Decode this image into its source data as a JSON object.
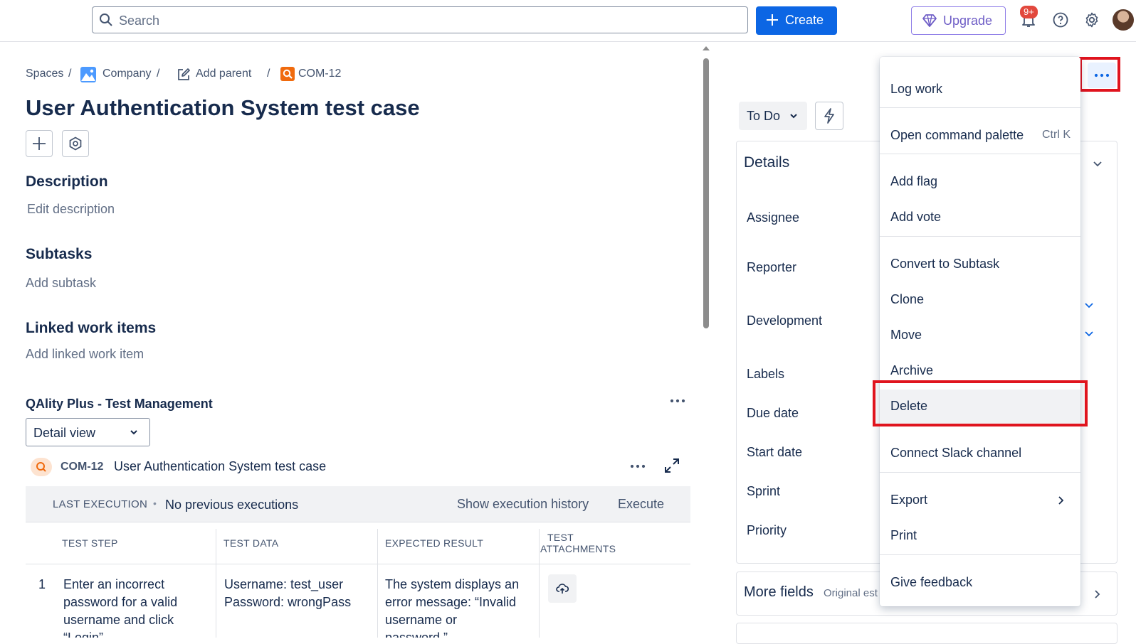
{
  "topbar": {
    "search_placeholder": "Search",
    "create_label": "Create",
    "upgrade_label": "Upgrade",
    "notification_badge": "9+"
  },
  "breadcrumb": {
    "spaces": "Spaces",
    "company": "Company",
    "add_parent": "Add parent",
    "issue_key": "COM-12",
    "separator": "/"
  },
  "issue": {
    "title": "User Authentication System test case"
  },
  "sections": {
    "description_heading": "Description",
    "description_placeholder": "Edit description",
    "subtasks_heading": "Subtasks",
    "subtasks_placeholder": "Add subtask",
    "linked_heading": "Linked work items",
    "linked_placeholder": "Add linked work item"
  },
  "qality": {
    "heading": "QAlity Plus - Test Management",
    "view_select": "Detail view",
    "issue_key": "COM-12",
    "issue_title": "User Authentication System test case",
    "last_execution_label": "LAST EXECUTION",
    "last_execution_value": "No previous executions",
    "show_history": "Show execution history",
    "execute": "Execute",
    "columns": [
      "TEST STEP",
      "TEST DATA",
      "EXPECTED RESULT",
      "TEST",
      "ATTACHMENTS"
    ],
    "rows": [
      {
        "num": "1",
        "step": [
          "Enter an incorrect",
          "password for a valid",
          "username and click",
          "“Login”"
        ],
        "data": [
          "Username: test_user",
          "Password: wrongPass"
        ],
        "expected": [
          "The system displays an",
          "error message: “Invalid",
          "username or",
          "password.”"
        ]
      }
    ]
  },
  "right_panel": {
    "status": "To Do",
    "details_heading": "Details",
    "fields": [
      "Assignee",
      "Reporter",
      "Development",
      "Labels",
      "Due date",
      "Start date",
      "Sprint",
      "Priority"
    ],
    "more_fields": "More fields",
    "more_fields_hint": "Original est"
  },
  "menu": {
    "items": {
      "log_work": "Log work",
      "command_palette": "Open command palette",
      "command_palette_shortcut": "Ctrl K",
      "add_flag": "Add flag",
      "add_vote": "Add vote",
      "convert": "Convert to Subtask",
      "clone": "Clone",
      "move": "Move",
      "archive": "Archive",
      "delete": "Delete",
      "slack": "Connect Slack channel",
      "export": "Export",
      "print": "Print",
      "feedback": "Give feedback"
    }
  },
  "colors": {
    "brand_blue": "#0c66e4",
    "highlight_red": "#e0141e",
    "upgrade_purple": "#6e5dc6",
    "issue_orange": "#f06a0d"
  }
}
